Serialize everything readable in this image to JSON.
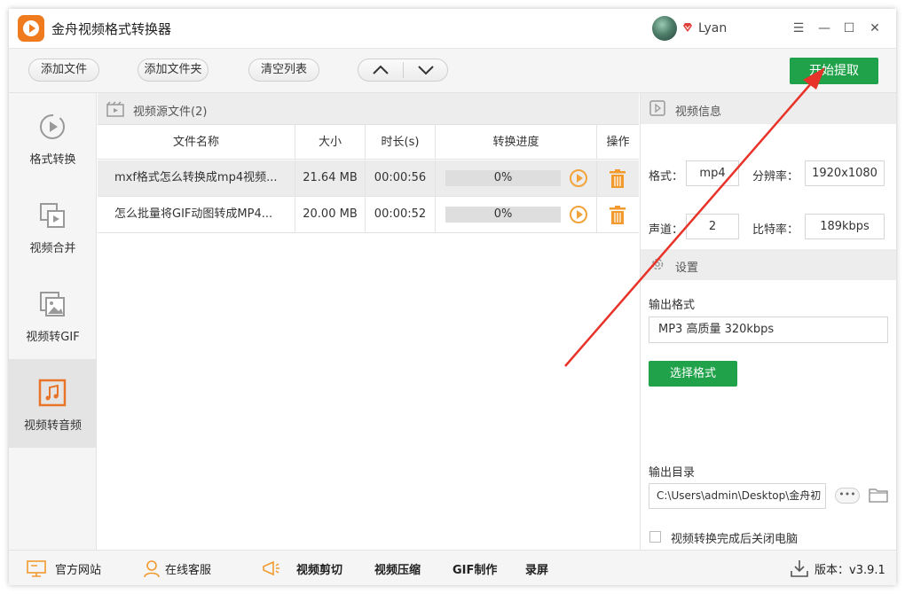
{
  "app": {
    "title": "金舟视频格式转换器"
  },
  "user": {
    "name": "Lyan"
  },
  "window_controls": {
    "menu": "☰",
    "minimize": "—",
    "maximize": "☐",
    "close": "✕"
  },
  "toolbar": {
    "add_file": "添加文件",
    "add_folder": "添加文件夹",
    "clear_list": "清空列表",
    "start": "开始提取"
  },
  "sidebar": {
    "items": [
      {
        "label": "格式转换",
        "icon": "convert-icon"
      },
      {
        "label": "视频合并",
        "icon": "merge-icon"
      },
      {
        "label": "视频转GIF",
        "icon": "gif-icon"
      },
      {
        "label": "视频转音频",
        "icon": "music-icon",
        "active": true
      }
    ]
  },
  "file_list": {
    "title": "视频源文件(2)",
    "columns": [
      "文件名称",
      "大小",
      "时长(s)",
      "转换进度",
      "操作"
    ],
    "rows": [
      {
        "name": "mxf格式怎么转换成mp4视频...",
        "size": "21.64 MB",
        "duration": "00:00:56",
        "progress": "0%"
      },
      {
        "name": "怎么批量将GIF动图转成MP4...",
        "size": "20.00 MB",
        "duration": "00:00:52",
        "progress": "0%"
      }
    ]
  },
  "video_info": {
    "title": "视频信息",
    "format_label": "格式：",
    "format_value": "mp4",
    "resolution_label": "分辨率：",
    "resolution_value": "1920x1080",
    "channels_label": "声道：",
    "channels_value": "2",
    "bitrate_label": "比特率：",
    "bitrate_value": "189kbps"
  },
  "settings": {
    "title": "设置",
    "output_format_label": "输出格式",
    "output_format_value": "MP3 高质量 320kbps",
    "choose_format": "选择格式",
    "output_dir_label": "输出目录",
    "output_dir_value": "C:\\Users\\admin\\Desktop\\金舟初",
    "more": "•••",
    "shutdown_label": "视频转换完成后关闭电脑"
  },
  "bottom": {
    "website": "官方网站",
    "support": "在线客服",
    "cut": "视频剪切",
    "compress": "视频压缩",
    "gif": "GIF制作",
    "record": "录屏",
    "version": "版本：v3.9.1"
  },
  "colors": {
    "accent": "#1fa24a",
    "brand": "#f07b1e",
    "annotation": "#e8332a"
  }
}
